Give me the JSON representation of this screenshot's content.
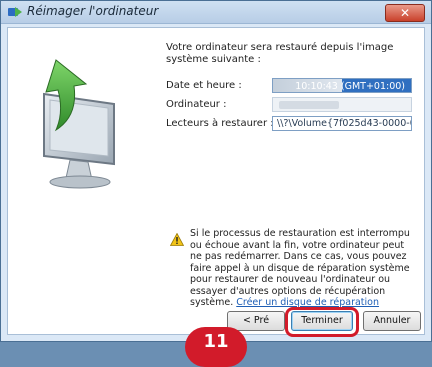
{
  "window": {
    "title": "Réimager l'ordinateur",
    "close_glyph": "✕"
  },
  "intro": "Votre ordinateur sera restauré depuis l'image système suivante :",
  "fields": {
    "date": {
      "label": "Date et heure :",
      "value": "10:10:43 (GMT+01:00)"
    },
    "computer": {
      "label": "Ordinateur :",
      "value": ""
    },
    "drives": {
      "label": "Lecteurs à restaurer :",
      "value": "\\\\?\\Volume{7f025d43-0000-0000-"
    }
  },
  "warning": {
    "text": "Si le processus de restauration est interrompu ou échoue avant la fin, votre ordinateur peut ne pas redémarrer. Dans ce cas, vous pouvez faire appel à un disque de réparation système pour restaurer de nouveau l'ordinateur ou essayer d'autres options de récupération système.",
    "link": "Créer un disque de réparation"
  },
  "buttons": {
    "previous": "< Pré",
    "finish": "Terminer",
    "cancel": "Annuler"
  },
  "overlay": {
    "step_badge": "11"
  },
  "colors": {
    "accent": "#2f6fc0",
    "highlight": "#d21b2a",
    "link": "#1f5fb5"
  }
}
